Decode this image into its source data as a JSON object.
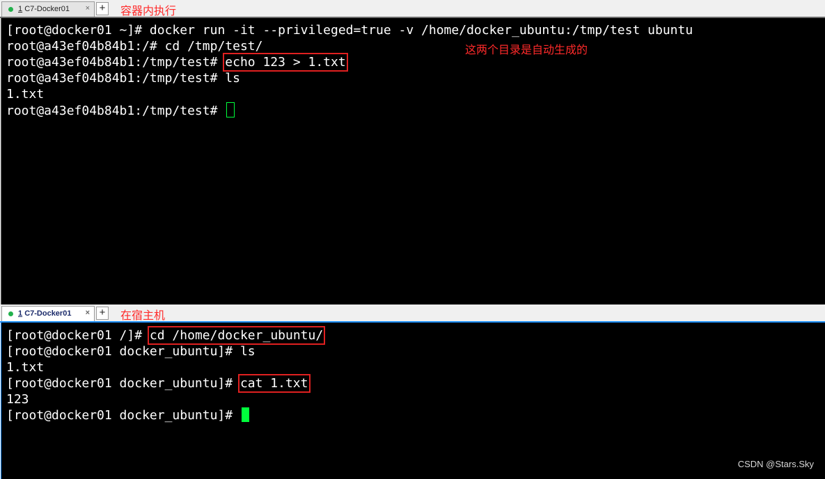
{
  "top_pane": {
    "tab": {
      "number": "1",
      "title": "C7-Docker01",
      "close": "×"
    },
    "add_tab": "+",
    "annotation": "容器内执行",
    "terminal_annotation": "这两个目录是自动生成的",
    "lines": [
      {
        "prompt": "[root@docker01 ~]#",
        "command": " docker run -it --privileged=true -v /home/docker_ubuntu:/tmp/test ubuntu"
      },
      {
        "prompt": "root@a43ef04b84b1:/#",
        "command": " cd /tmp/test/"
      },
      {
        "prompt": "root@a43ef04b84b1:/tmp/test#",
        "command": "echo 123 > 1.txt"
      },
      {
        "prompt": "root@a43ef04b84b1:/tmp/test#",
        "command": " ls"
      },
      {
        "output": "1.txt"
      },
      {
        "prompt": "root@a43ef04b84b1:/tmp/test#",
        "command": " "
      }
    ],
    "accent_color": "#6a6a6a"
  },
  "bottom_pane": {
    "tab": {
      "number": "1",
      "title": "C7-Docker01",
      "close": "×"
    },
    "add_tab": "+",
    "annotation": "在宿主机",
    "lines": [
      {
        "prompt": "[root@docker01 /]#",
        "command": "cd /home/docker_ubuntu/"
      },
      {
        "prompt": "[root@docker01 docker_ubuntu]#",
        "command": " ls"
      },
      {
        "output": "1.txt"
      },
      {
        "prompt": "[root@docker01 docker_ubuntu]#",
        "command": "cat 1.txt"
      },
      {
        "output": "123"
      },
      {
        "prompt": "[root@docker01 docker_ubuntu]#",
        "command": " "
      }
    ],
    "accent_color": "#1e90ff"
  },
  "watermark": "CSDN @Stars.Sky",
  "colors": {
    "terminal_bg": "#000000",
    "terminal_fg": "#ffffff",
    "cursor": "#00ff3c",
    "annotation": "#ff2a2a",
    "highlight_box": "#e02020",
    "tab_dot": "#22b14c"
  }
}
